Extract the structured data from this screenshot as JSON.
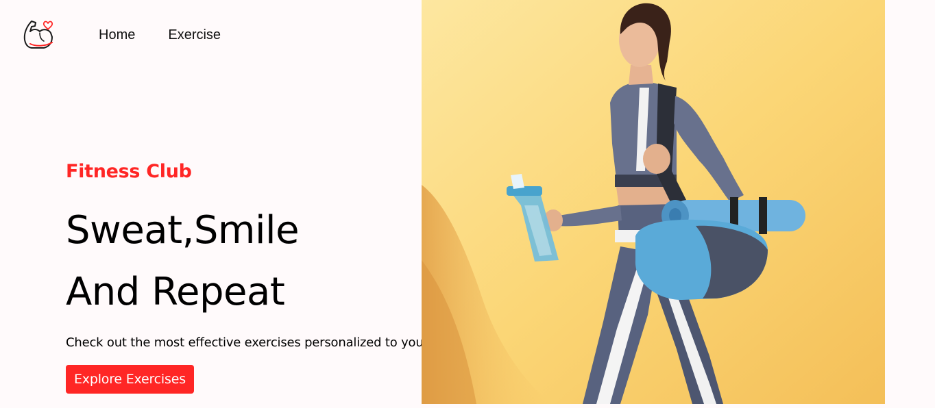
{
  "nav": {
    "logo_icon": "flexed-bicep-heart-icon",
    "links": [
      {
        "label": "Home"
      },
      {
        "label": "Exercise"
      }
    ]
  },
  "hero": {
    "kicker": "Fitness Club",
    "title_line1": "Sweat,Smile",
    "title_line2": "And Repeat",
    "subtitle": "Check out the most effective exercises personalized to you",
    "cta_label": "Explore Exercises"
  },
  "colors": {
    "accent": "#ff2625",
    "background": "#fffafb",
    "image_background": "#fbd46e"
  },
  "banner_image": {
    "icon": "woman-with-yoga-mat-and-shaker-illustration"
  }
}
